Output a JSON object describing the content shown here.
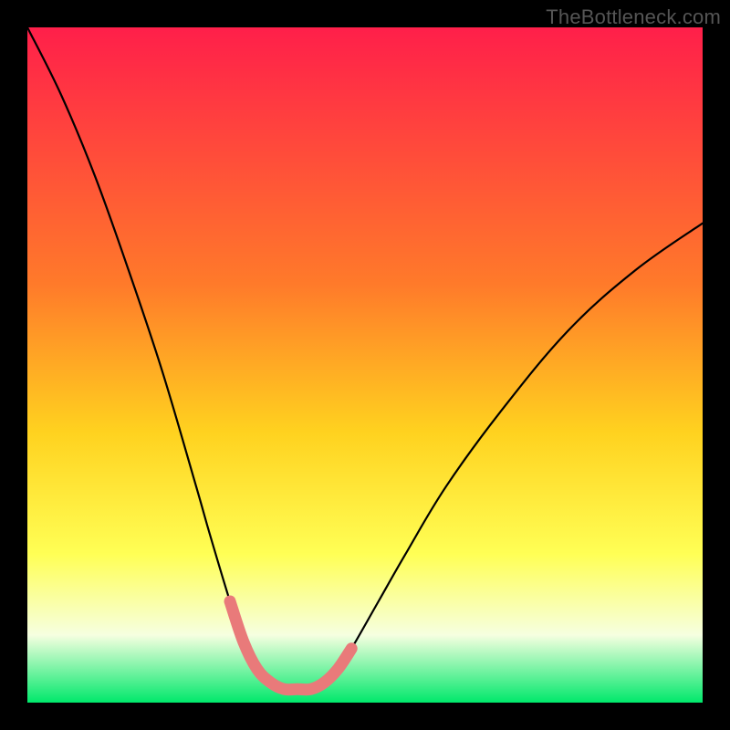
{
  "watermark": "TheBottleneck.com",
  "colors": {
    "page_bg": "#000000",
    "gradient_top": "#ff1f4a",
    "gradient_mid1": "#ff7a2a",
    "gradient_mid2": "#ffd21f",
    "gradient_mid3": "#ffff55",
    "gradient_low": "#f6ffe0",
    "gradient_bottom": "#00e86b",
    "curve": "#000000",
    "highlight": "#e97a7a"
  },
  "chart_data": {
    "type": "line",
    "title": "",
    "xlabel": "",
    "ylabel": "",
    "xlim": [
      0,
      100
    ],
    "ylim": [
      0,
      100
    ],
    "grid": false,
    "legend": false,
    "annotations": [],
    "series": [
      {
        "name": "bottleneck-curve",
        "x": [
          0,
          5,
          10,
          15,
          20,
          25,
          27,
          30,
          32,
          34,
          36,
          38,
          40,
          42,
          44,
          46,
          48,
          52,
          56,
          62,
          70,
          80,
          90,
          100
        ],
        "values": [
          100,
          90,
          78,
          64,
          49,
          32,
          25,
          15,
          9,
          5,
          3,
          2,
          2,
          2,
          3,
          5,
          8,
          15,
          22,
          32,
          43,
          55,
          64,
          71
        ]
      },
      {
        "name": "highlight-segment",
        "x": [
          30,
          32,
          34,
          36,
          38,
          40,
          42,
          44,
          46,
          48
        ],
        "values": [
          15,
          9,
          5,
          3,
          2,
          2,
          2,
          3,
          5,
          8
        ]
      }
    ]
  }
}
